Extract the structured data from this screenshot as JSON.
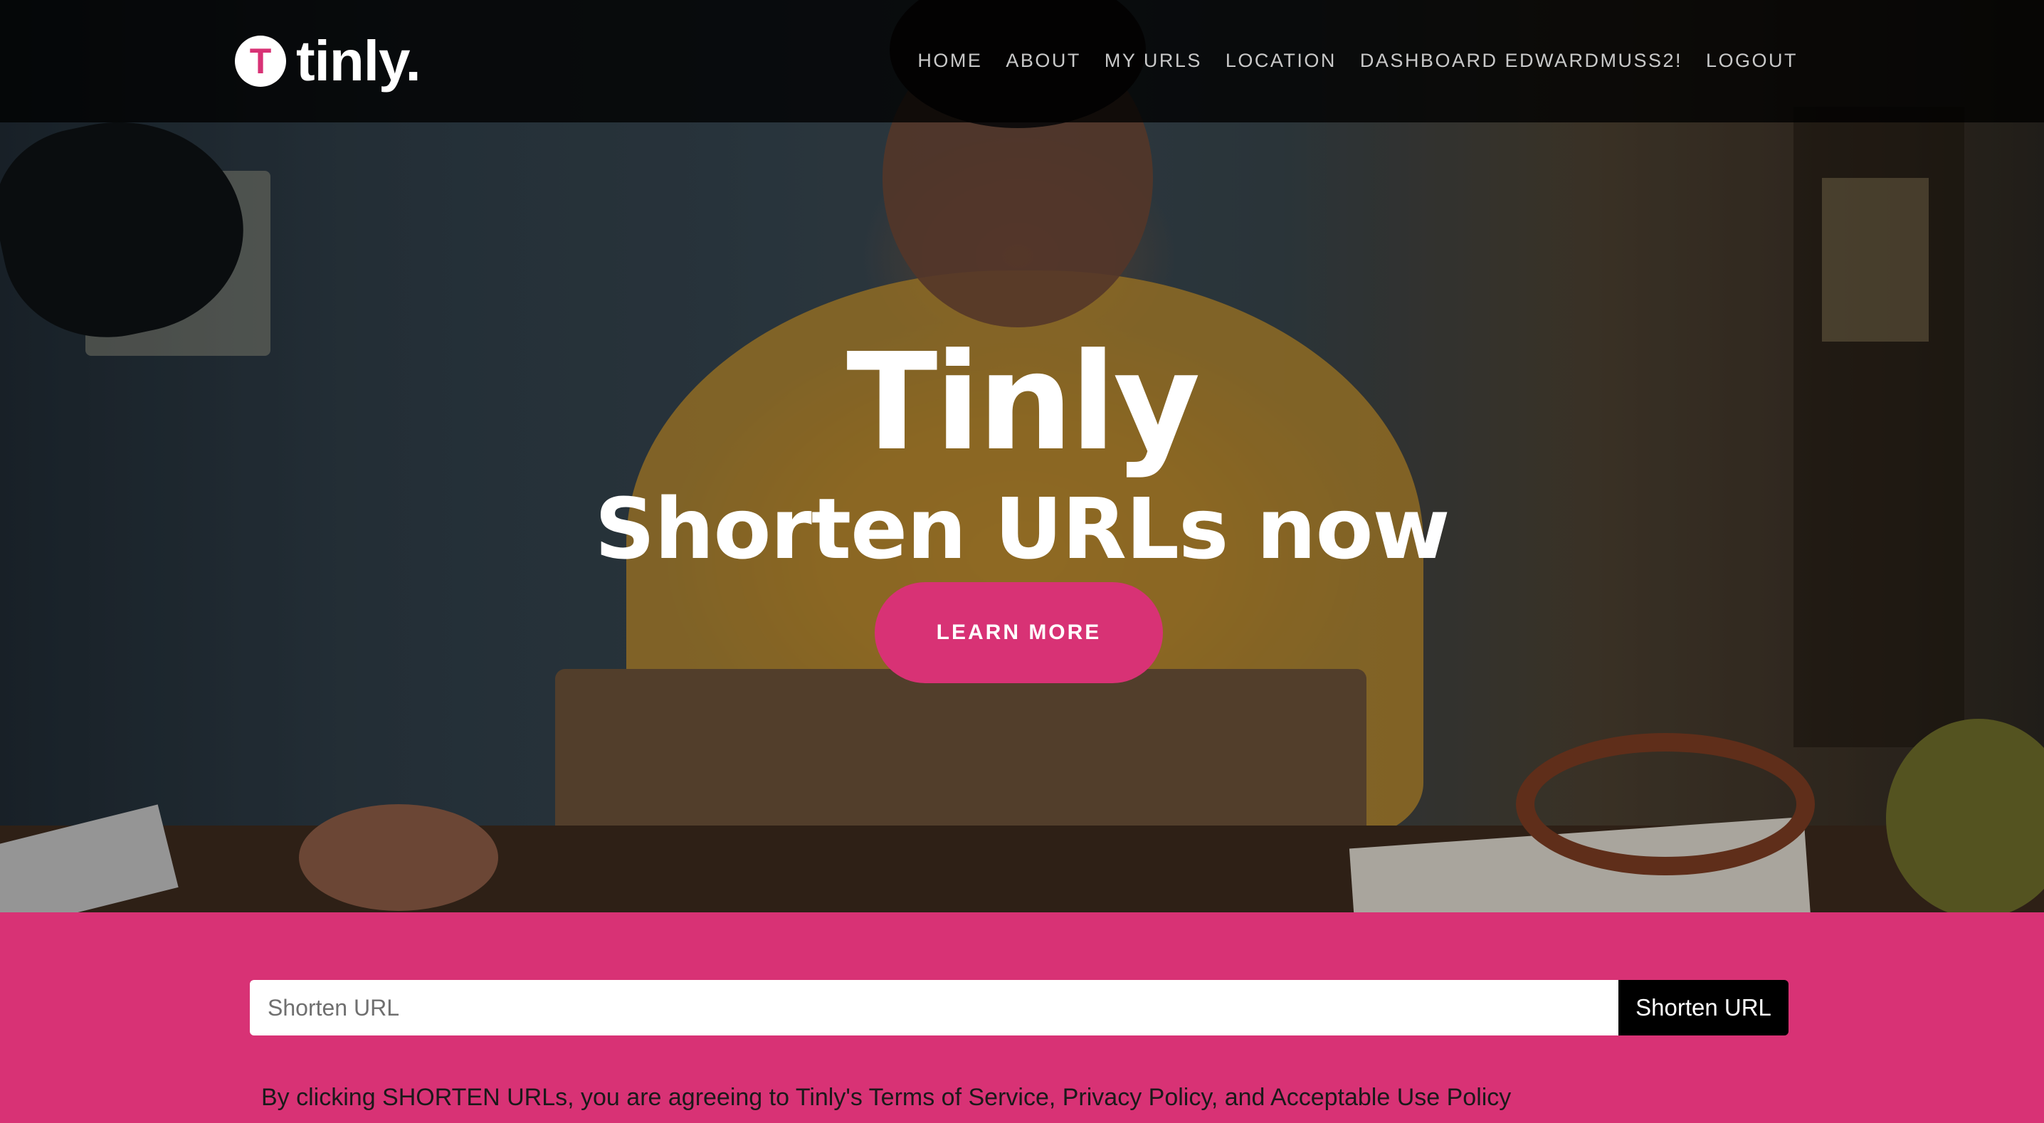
{
  "brand": {
    "logo_letter": "T",
    "name": "tinly."
  },
  "nav": {
    "items": [
      {
        "label": "HOME"
      },
      {
        "label": "ABOUT"
      },
      {
        "label": "MY URLS"
      },
      {
        "label": "LOCATION"
      },
      {
        "label": "DASHBOARD EDWARDMUSS2!"
      },
      {
        "label": "LOGOUT"
      }
    ]
  },
  "hero": {
    "title": "Tinly",
    "subtitle": "Shorten URLs now",
    "cta_label": "LEARN MORE"
  },
  "shorten": {
    "input_value": "",
    "input_placeholder": "Shorten URL",
    "button_label": "Shorten URL",
    "disclaimer": "By clicking SHORTEN URLs, you are agreeing to Tinly's Terms of Service, Privacy Policy, and Acceptable Use Policy"
  },
  "colors": {
    "accent": "#d83275",
    "navbar_bg": "#000000",
    "button_dark": "#000000",
    "nav_text": "#c9c9c9"
  }
}
